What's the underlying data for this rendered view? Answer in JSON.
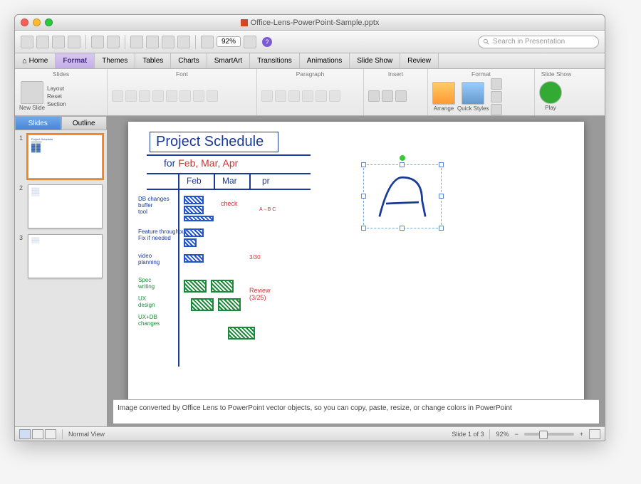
{
  "window": {
    "title": "Office-Lens-PowerPoint-Sample.pptx"
  },
  "toolbar": {
    "zoom": "92%"
  },
  "search": {
    "placeholder": "Search in Presentation"
  },
  "tabs": [
    "Home",
    "Format",
    "Themes",
    "Tables",
    "Charts",
    "SmartArt",
    "Transitions",
    "Animations",
    "Slide Show",
    "Review"
  ],
  "ribbon": {
    "groups": [
      "Slides",
      "Font",
      "Paragraph",
      "Insert",
      "Format",
      "Slide Show"
    ],
    "new_slide": "New Slide",
    "layout": "Layout",
    "reset": "Reset",
    "section": "Section",
    "arrange": "Arrange",
    "quick_styles": "Quick Styles",
    "play": "Play"
  },
  "panel": {
    "slides_tab": "Slides",
    "outline_tab": "Outline",
    "count": 3
  },
  "slide": {
    "title": "Project  Schedule",
    "subtitle_prefix": "for   ",
    "subtitle_months": "Feb, Mar, Apr",
    "months": [
      "Feb",
      "Mar",
      "pr"
    ],
    "rows_blue": [
      "DB changes",
      "buffer",
      "tool",
      "Feature throughput",
      "Fix if needed",
      "video",
      "planning"
    ],
    "rows_green": [
      "Spec",
      "writing",
      "UX",
      "design",
      "UX+DB",
      "changes"
    ],
    "check": "check",
    "review": "Review\n(3/25)",
    "annot": "A→B\nC",
    "date": "3/30"
  },
  "notes": "Image converted by Office Lens to PowerPoint vector objects, so you can copy, paste, resize, or change colors in PowerPoint",
  "status": {
    "view": "Normal View",
    "slide_of": "Slide 1 of 3",
    "zoom": "92%"
  }
}
